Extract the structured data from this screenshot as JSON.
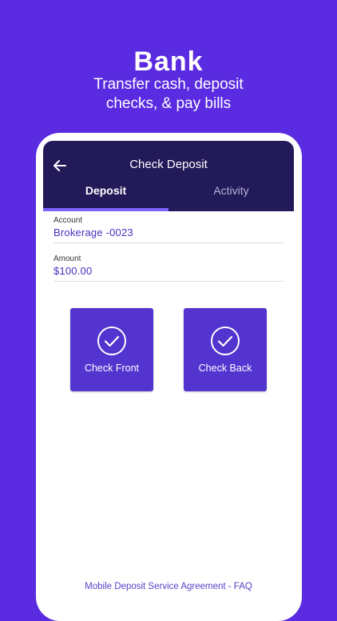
{
  "promo": {
    "title": "Bank",
    "subtitle_line1": "Transfer cash, deposit",
    "subtitle_line2": "checks, & pay bills"
  },
  "header": {
    "title": "Check Deposit",
    "back_icon": "arrow-left-icon"
  },
  "tabs": [
    {
      "label": "Deposit",
      "active": true
    },
    {
      "label": "Activity",
      "active": false
    }
  ],
  "form": {
    "account": {
      "label": "Account",
      "value": "Brokerage -0023"
    },
    "amount": {
      "label": "Amount",
      "value": "$100.00"
    }
  },
  "capture": {
    "front_label": "Check Front",
    "back_label": "Check Back",
    "icon": "check-circle-icon"
  },
  "footer": {
    "link": "Mobile Deposit Service Agreement - FAQ"
  },
  "colors": {
    "background": "#5a2be0",
    "header": "#221a59",
    "accent": "#5334cf",
    "tab_indicator": "#7c63ff",
    "link": "#4530c0"
  }
}
